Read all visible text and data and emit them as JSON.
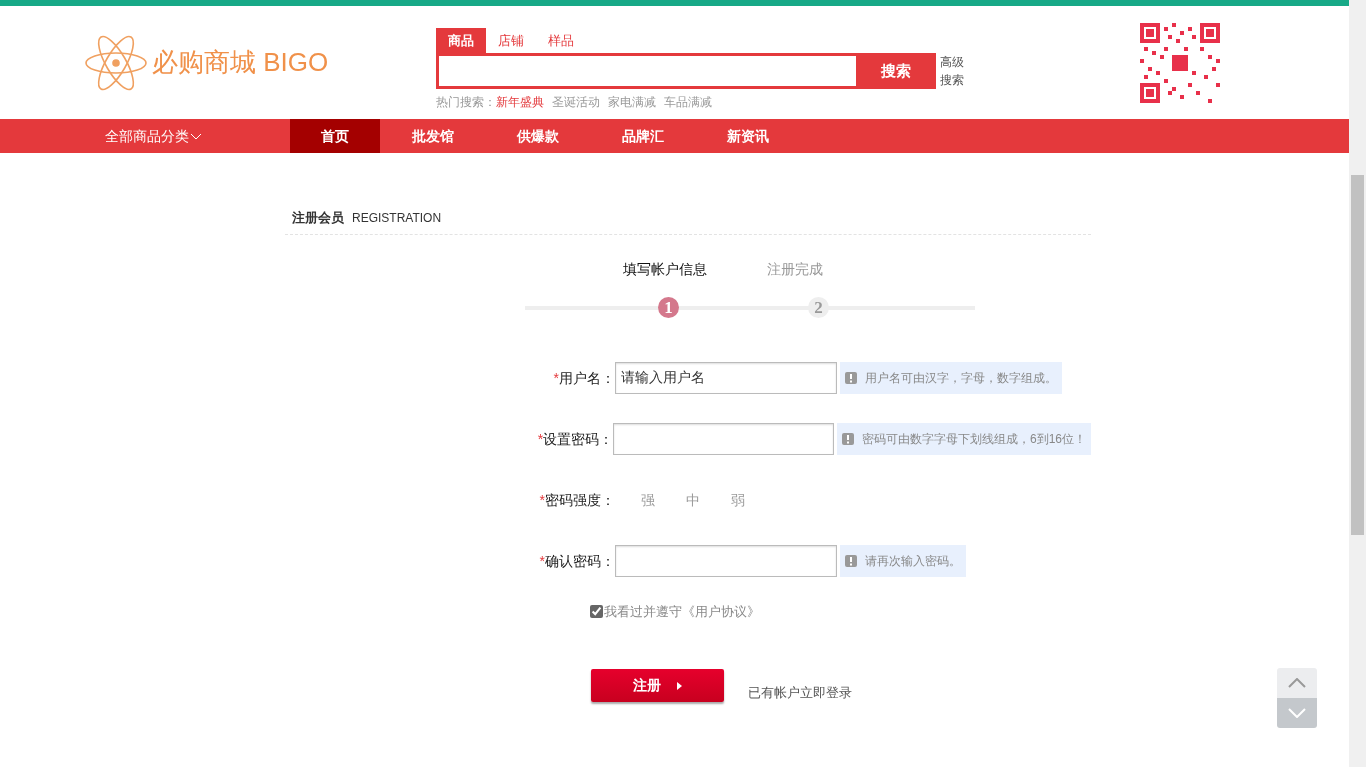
{
  "header": {
    "logo": "必购商城 BIGO",
    "search_tabs": [
      {
        "label": "商品",
        "selected": true
      },
      {
        "label": "店铺",
        "selected": false
      },
      {
        "label": "样品",
        "selected": false
      }
    ],
    "search_button": "搜索",
    "advanced_search": "高级搜索",
    "hot_label": "热门搜索：",
    "hot_terms": [
      {
        "label": "新年盛典",
        "highlighted": true
      },
      {
        "label": "圣诞活动",
        "highlighted": false
      },
      {
        "label": "家电满减",
        "highlighted": false
      },
      {
        "label": "车品满减",
        "highlighted": false
      }
    ]
  },
  "nav": {
    "category": "全部商品分类",
    "items": [
      {
        "label": "首页",
        "selected": true
      },
      {
        "label": "批发馆",
        "selected": false
      },
      {
        "label": "供爆款",
        "selected": false
      },
      {
        "label": "品牌汇",
        "selected": false
      },
      {
        "label": "新资讯",
        "selected": false
      }
    ]
  },
  "registration": {
    "title": "注册会员",
    "subtitle": "REGISTRATION",
    "required_mark": "*",
    "steps": [
      {
        "label": "填写帐户信息",
        "number": "1",
        "active": true
      },
      {
        "label": "注册完成",
        "number": "2",
        "active": false
      }
    ],
    "fields": [
      {
        "kind": "input",
        "label": "用户名：",
        "required": true,
        "value": "请输入用户名",
        "hint": "用户名可由汉字，字母，数字组成。"
      },
      {
        "kind": "input",
        "label": "设置密码：",
        "required": true,
        "hint": "密码可由数字字母下划线组成，6到16位！"
      },
      {
        "kind": "strength",
        "label": "密码强度：",
        "required": true,
        "levels": [
          "强",
          "中",
          "弱"
        ]
      },
      {
        "kind": "input",
        "label": "确认密码：",
        "required": true,
        "hint": "请再次输入密码。"
      }
    ],
    "agreement": {
      "checked": true,
      "text": "我看过并遵守《用户协议》"
    },
    "submit": "注册",
    "login_link": "已有帐户立即登录"
  }
}
